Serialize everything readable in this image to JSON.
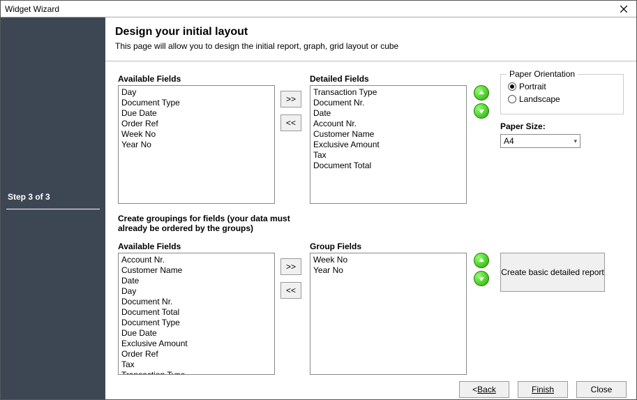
{
  "window": {
    "title": "Widget Wizard"
  },
  "sidebar": {
    "step": "Step 3 of 3"
  },
  "header": {
    "title": "Design your initial layout",
    "subtitle": "This page will allow you to design the initial report, graph, grid layout or cube"
  },
  "top": {
    "available_label": "Available Fields",
    "available": [
      "Day",
      "Document Type",
      "Due Date",
      "Order Ref",
      "Week No",
      "Year No"
    ],
    "move_right": ">>",
    "move_left": "<<",
    "detailed_label": "Detailed Fields",
    "detailed": [
      "Transaction Type",
      "Document Nr.",
      "Date",
      "Account Nr.",
      "Customer Name",
      "Exclusive Amount",
      "Tax",
      "Document Total"
    ]
  },
  "orientation": {
    "legend": "Paper Orientation",
    "portrait": "Portrait",
    "landscape": "Landscape",
    "selected": "portrait"
  },
  "paper_size": {
    "label": "Paper Size:",
    "value": "A4"
  },
  "grouping_header": "Create groupings for fields (your data must already be ordered by the groups)",
  "bottom": {
    "available_label": "Available Fields",
    "available": [
      "Account Nr.",
      "Customer Name",
      "Date",
      "Day",
      "Document Nr.",
      "Document Total",
      "Document Type",
      "Due Date",
      "Exclusive Amount",
      "Order Ref",
      "Tax",
      "Transaction Type"
    ],
    "move_right": ">>",
    "move_left": "<<",
    "group_label": "Group Fields",
    "group": [
      "Week No",
      "Year No"
    ]
  },
  "create_button": "Create basic detailed report",
  "footer": {
    "back": "Back",
    "finish": "Finish",
    "close": "Close"
  }
}
